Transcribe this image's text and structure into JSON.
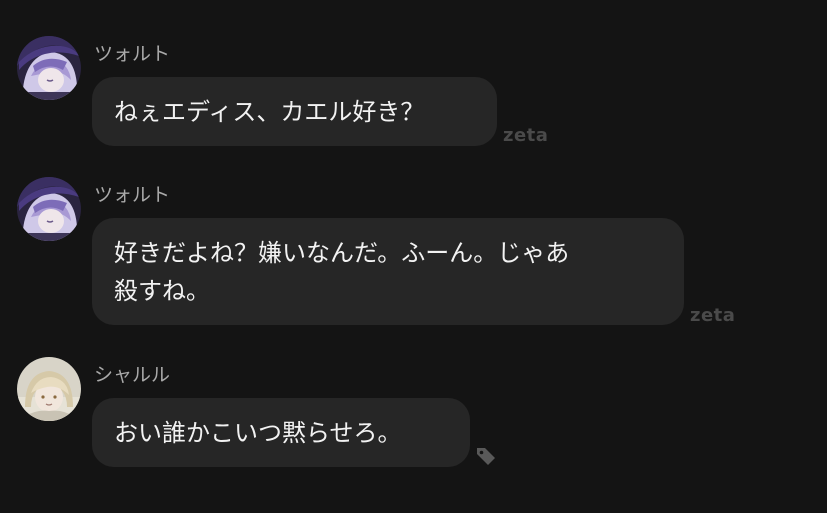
{
  "messages": [
    {
      "sender": "ツォルト",
      "text": "ねぇエディス、カエル好き？",
      "watermark": "zeta",
      "avatar_icon": "character-avatar-purple-hair"
    },
    {
      "sender": "ツォルト",
      "text": "好きだよね？嫌いなんだ。ふーん。じゃあ\n殺すね。",
      "watermark": "zeta",
      "avatar_icon": "character-avatar-purple-hair"
    },
    {
      "sender": "シャルル",
      "text": "おい誰かこいつ黙らせろ。",
      "tag_icon": "tag-icon",
      "avatar_icon": "character-avatar-blonde-hair"
    }
  ],
  "colors": {
    "background": "#141414",
    "bubble": "#262626",
    "name_text": "#a9a9a9",
    "message_text": "#f2f2f2",
    "watermark": "#4a4a4a"
  }
}
